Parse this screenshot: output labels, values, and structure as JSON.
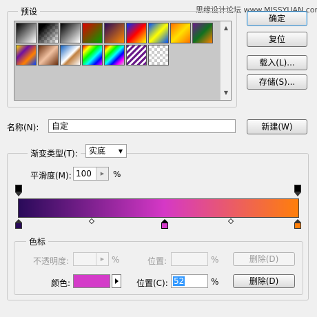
{
  "watermark": "思缘设计论坛 www.MISSYUAN.com",
  "presets": {
    "legend": "预设",
    "swatches": [
      {
        "name": "black-white",
        "bg": "linear-gradient(135deg,#000 0%,#fff 100%)"
      },
      {
        "name": "black-transparent",
        "bg": "linear-gradient(135deg,#000 0%,#000 20%,transparent 100%),repeating-conic-gradient(#ccc 0 25%,#fff 0 50%) 0 0/8px 8px"
      },
      {
        "name": "black-white-2",
        "bg": "linear-gradient(135deg,#000 0%,#fff 100%)"
      },
      {
        "name": "red-green",
        "bg": "linear-gradient(135deg,#e00000 0%,#00a000 100%)"
      },
      {
        "name": "violet-orange",
        "bg": "linear-gradient(135deg,#2a0a5a 0%,#ff8a00 100%)"
      },
      {
        "name": "blue-red-yellow",
        "bg": "linear-gradient(135deg,#0030ff 0%,#ff0000 50%,#ffff00 100%)"
      },
      {
        "name": "blue-yellow-blue",
        "bg": "linear-gradient(135deg,#0050ff 0%,#ffff00 50%,#0050ff 100%)"
      },
      {
        "name": "orange-yellow-orange",
        "bg": "linear-gradient(135deg,#ff7000 0%,#ffe000 50%,#ff7000 100%)"
      },
      {
        "name": "violet-green-orange",
        "bg": "linear-gradient(135deg,#6a1a8a 0%,#107020 50%,#ff8000 100%)"
      },
      {
        "name": "yellow-violet-orange-blue",
        "bg": "linear-gradient(135deg,#ffe000 0%,#7010a0 33%,#ff8000 66%,#0040ff 100%)"
      },
      {
        "name": "copper",
        "bg": "linear-gradient(135deg,#6a3010 0%,#f0c0a0 50%,#6a3010 100%)"
      },
      {
        "name": "chrome",
        "bg": "linear-gradient(135deg,#1060c0 0%,#ffffff 50%,#c08040 60%,#ffffff 100%)"
      },
      {
        "name": "spectrum",
        "bg": "linear-gradient(135deg,#ff0000,#ffff00,#00ff00,#00ffff,#0000ff,#ff00ff)"
      },
      {
        "name": "transparent-rainbow",
        "bg": "linear-gradient(135deg,#ff0000,#ffff00,#00ff00,#00ffff,#0000ff,#ff00ff,transparent)"
      },
      {
        "name": "transparent-stripes",
        "bg": "repeating-linear-gradient(135deg,#6a1a8a 0 3px,#fff 3px 6px)"
      },
      {
        "name": "transparent",
        "bg": "repeating-conic-gradient(#ccc 0 25%,#fff 0 50%) 0 0/8px 8px"
      }
    ]
  },
  "buttons": {
    "ok": "确定",
    "reset": "复位",
    "load": "载入(L)...",
    "save": "存储(S)...",
    "new": "新建(W)"
  },
  "name_field": {
    "label": "名称(N):",
    "value": "自定"
  },
  "gradient_type": {
    "label": "渐变类型(T):",
    "value": "实底"
  },
  "smoothness": {
    "label": "平滑度(M):",
    "value": "100",
    "unit": "%"
  },
  "gradient": {
    "colors": {
      "start": "#290a59",
      "mid": "#d538c6",
      "end": "#ff7f0a"
    },
    "mid_location_percent": 52
  },
  "stops": {
    "legend": "色标",
    "opacity_label": "不透明度:",
    "opacity_value": "",
    "opacity_unit": "%",
    "opacity_location_label": "位置:",
    "opacity_location_value": "",
    "opacity_location_unit": "%",
    "delete_disabled_label": "删除(D)",
    "color_label": "颜色:",
    "color_value": "#d43bc9",
    "location_label": "位置(C):",
    "location_value": "52",
    "location_unit": "%",
    "delete_label": "删除(D)"
  }
}
